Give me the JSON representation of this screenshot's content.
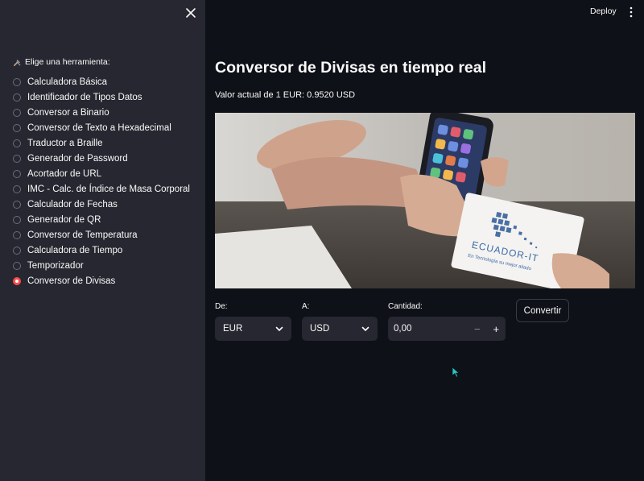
{
  "sidebar": {
    "prompt_label": "Elige una herramienta:",
    "prompt_icon": "tools-icon",
    "selected_index": 13,
    "items": [
      {
        "label": "Calculadora Básica"
      },
      {
        "label": "Identificador de Tipos Datos"
      },
      {
        "label": "Conversor a Binario"
      },
      {
        "label": "Conversor de Texto a Hexadecimal"
      },
      {
        "label": "Traductor a Braille"
      },
      {
        "label": "Generador de Password"
      },
      {
        "label": "Acortador de URL"
      },
      {
        "label": "IMC - Calc. de Índice de Masa Corporal"
      },
      {
        "label": "Calculador de Fechas"
      },
      {
        "label": "Generador de QR"
      },
      {
        "label": "Conversor de Temperatura"
      },
      {
        "label": "Calculadora de Tiempo"
      },
      {
        "label": "Temporizador"
      },
      {
        "label": "Conversor de Divisas"
      }
    ]
  },
  "header": {
    "deploy_label": "Deploy"
  },
  "main": {
    "title": "Conversor de Divisas en tiempo real",
    "rate_prefix": "Valor actual de ",
    "rate_amount": "1",
    "rate_suffix": " EUR: 0.9520 USD",
    "hero": {
      "card_brand": "ECUADOR-IT",
      "card_tagline": "En Tecnología su mejor aliado"
    },
    "from": {
      "label": "De:",
      "value": "EUR"
    },
    "to": {
      "label": "A:",
      "value": "USD"
    },
    "amount": {
      "label": "Cantidad:",
      "value": "0,00"
    },
    "convert_label": "Convertir"
  },
  "colors": {
    "background": "#0e1117",
    "sidebar": "#262730",
    "accent": "#ff4b4b"
  }
}
